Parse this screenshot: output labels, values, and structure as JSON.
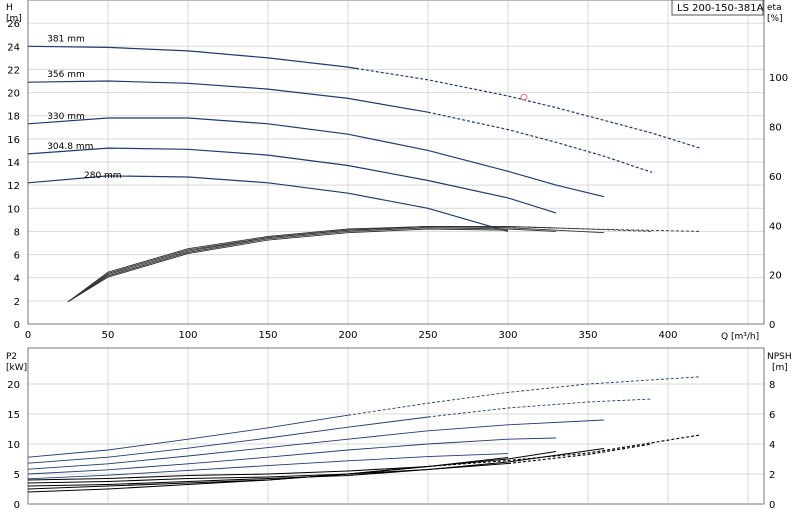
{
  "title": "LS 200-150-381A",
  "chart_data": [
    {
      "type": "line",
      "panel": "head-efficiency",
      "title": "LS 200-150-381A",
      "xlabel": "Q [m³/h]",
      "ylabel_left_top": "H",
      "ylabel_left_unit": "[m]",
      "ylabel_right_top": "eta",
      "ylabel_right_unit": "[%]",
      "xlim": [
        0,
        460
      ],
      "ylim_left": [
        0,
        28
      ],
      "ylim_right": [
        0,
        131.25
      ],
      "x_ticks": [
        0,
        50,
        100,
        150,
        200,
        250,
        300,
        350,
        400
      ],
      "y_left_ticks": [
        0,
        2,
        4,
        6,
        8,
        10,
        12,
        14,
        16,
        18,
        20,
        22,
        24,
        26
      ],
      "y_right_ticks": [
        0,
        20,
        40,
        60,
        80,
        100
      ],
      "grid": true,
      "curve_labels": [
        "381 mm",
        "356 mm",
        "330 mm",
        "304.8 mm",
        "280 mm"
      ],
      "head_series": [
        {
          "name": "381 mm",
          "color": "#1f3c6e",
          "x": [
            0,
            50,
            100,
            150,
            200,
            250,
            300,
            330,
            360,
            390,
            420
          ],
          "y": [
            24.0,
            23.9,
            23.6,
            23.0,
            22.2,
            21.1,
            19.7,
            18.7,
            17.6,
            16.5,
            15.2
          ],
          "dashed_from_x": 205
        },
        {
          "name": "356 mm",
          "color": "#1f3c6e",
          "x": [
            0,
            50,
            100,
            150,
            200,
            250,
            300,
            330,
            360,
            390
          ],
          "y": [
            20.9,
            21.0,
            20.8,
            20.3,
            19.5,
            18.3,
            16.8,
            15.7,
            14.5,
            13.1
          ],
          "dashed_from_x": 250
        },
        {
          "name": "330 mm",
          "color": "#1f3c6e",
          "x": [
            0,
            50,
            100,
            150,
            200,
            250,
            300,
            330,
            360
          ],
          "y": [
            17.3,
            17.8,
            17.8,
            17.3,
            16.4,
            15.0,
            13.2,
            12.0,
            11.0
          ],
          "dashed_from_x": null
        },
        {
          "name": "304.8 mm",
          "color": "#1f3c6e",
          "x": [
            0,
            50,
            100,
            150,
            200,
            250,
            300,
            330
          ],
          "y": [
            14.7,
            15.2,
            15.1,
            14.6,
            13.7,
            12.4,
            10.9,
            9.6
          ],
          "dashed_from_x": null
        },
        {
          "name": "280 mm",
          "color": "#1f3c6e",
          "x": [
            0,
            50,
            100,
            150,
            200,
            250,
            300
          ],
          "y": [
            12.2,
            12.8,
            12.7,
            12.2,
            11.3,
            10.0,
            8.0
          ],
          "dashed_from_x": null
        }
      ],
      "eff_series": [
        {
          "x": [
            25,
            50,
            100,
            150,
            200,
            250,
            300,
            350,
            420
          ],
          "y": [
            9,
            21,
            30.5,
            35.5,
            38.5,
            39.5,
            39.5,
            38.5,
            37.5
          ],
          "dashed_from_x": 330
        },
        {
          "x": [
            25,
            50,
            100,
            150,
            200,
            250,
            300,
            350,
            390
          ],
          "y": [
            9,
            20.5,
            30,
            35,
            38,
            39.5,
            39.5,
            38.5,
            37.5
          ],
          "dashed_from_x": 300
        },
        {
          "x": [
            25,
            50,
            100,
            150,
            200,
            250,
            300,
            360
          ],
          "y": [
            9,
            20,
            29.5,
            35,
            38,
            39.5,
            39,
            37
          ],
          "dashed_from_x": null
        },
        {
          "x": [
            25,
            50,
            100,
            150,
            200,
            250,
            300,
            330
          ],
          "y": [
            9,
            19.5,
            29,
            34.5,
            37.5,
            39,
            38.5,
            37.5
          ],
          "dashed_from_x": null
        },
        {
          "x": [
            25,
            50,
            100,
            150,
            200,
            250,
            300
          ],
          "y": [
            9,
            19,
            28.5,
            34,
            37,
            38.5,
            38
          ],
          "dashed_from_x": null
        }
      ],
      "marker": {
        "x": 310,
        "y": 19.6,
        "color": "#e07070"
      }
    },
    {
      "type": "line",
      "panel": "power-npsh",
      "ylabel_left_top": "P2",
      "ylabel_left_unit": "[kW]",
      "ylabel_right_top": "NPSH",
      "ylabel_right_unit": "[m]",
      "xlim": [
        0,
        460
      ],
      "ylim_left": [
        0,
        26
      ],
      "ylim_right": [
        0,
        10.4
      ],
      "y_left_ticks": [
        0,
        5,
        10,
        15,
        20
      ],
      "y_right_ticks": [
        0,
        2,
        4,
        6,
        8
      ],
      "grid": true,
      "power_series": [
        {
          "x": [
            0,
            50,
            100,
            150,
            200,
            250,
            300,
            350,
            420
          ],
          "y": [
            7.8,
            9.0,
            10.8,
            12.7,
            14.8,
            16.8,
            18.6,
            20.0,
            21.2
          ],
          "dashed_from_x": 200
        },
        {
          "x": [
            0,
            50,
            100,
            150,
            200,
            250,
            300,
            350,
            390
          ],
          "y": [
            6.8,
            7.8,
            9.3,
            11.0,
            12.8,
            14.5,
            16.0,
            17.0,
            17.5
          ],
          "dashed_from_x": 250
        },
        {
          "x": [
            0,
            50,
            100,
            150,
            200,
            250,
            300,
            360
          ],
          "y": [
            5.8,
            6.7,
            8.0,
            9.4,
            10.8,
            12.2,
            13.2,
            14.0
          ],
          "dashed_from_x": null
        },
        {
          "x": [
            0,
            50,
            100,
            150,
            200,
            250,
            300,
            330
          ],
          "y": [
            5.0,
            5.7,
            6.7,
            7.8,
            9.0,
            10.0,
            10.8,
            11.0
          ],
          "dashed_from_x": null
        },
        {
          "x": [
            0,
            50,
            100,
            150,
            200,
            250,
            300
          ],
          "y": [
            4.2,
            4.8,
            5.6,
            6.4,
            7.2,
            7.9,
            8.4
          ],
          "dashed_from_x": null
        }
      ],
      "npsh_series": [
        {
          "x": [
            0,
            50,
            100,
            150,
            200,
            250,
            300,
            350,
            420
          ],
          "y": [
            1.6,
            1.7,
            1.9,
            2.0,
            2.2,
            2.5,
            2.9,
            3.4,
            4.6
          ],
          "dashed_from_x": 250
        },
        {
          "x": [
            0,
            50,
            100,
            150,
            200,
            250,
            300,
            350,
            390
          ],
          "y": [
            1.4,
            1.5,
            1.7,
            1.8,
            2.0,
            2.3,
            2.7,
            3.3,
            4.0
          ],
          "dashed_from_x": 300
        },
        {
          "x": [
            0,
            50,
            100,
            150,
            200,
            250,
            300,
            360
          ],
          "y": [
            1.2,
            1.3,
            1.5,
            1.7,
            1.9,
            2.3,
            2.8,
            3.7
          ],
          "dashed_from_x": null
        },
        {
          "x": [
            0,
            50,
            100,
            150,
            200,
            250,
            300,
            330
          ],
          "y": [
            1.0,
            1.2,
            1.4,
            1.6,
            2.0,
            2.5,
            3.0,
            3.5
          ],
          "dashed_from_x": null
        },
        {
          "x": [
            0,
            50,
            100,
            150,
            200,
            250,
            300
          ],
          "y": [
            0.8,
            1.0,
            1.3,
            1.6,
            2.0,
            2.5,
            3.1
          ],
          "dashed_from_x": null
        }
      ]
    }
  ]
}
